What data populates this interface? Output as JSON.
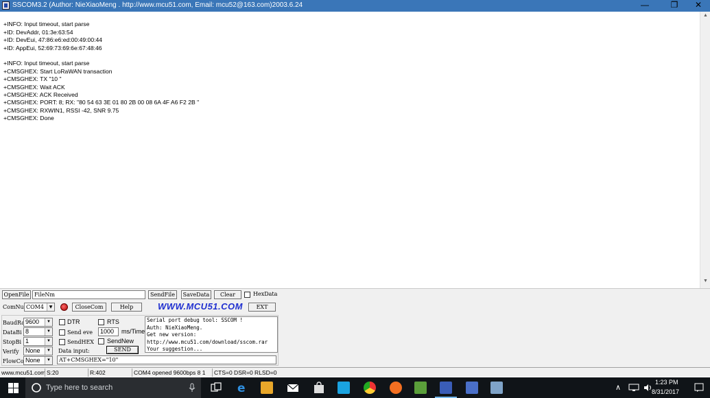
{
  "window": {
    "title": "SSCOM3.2 (Author: NieXiaoMeng .  http://www.mcu51.com,  Email: mcu52@163.com)2003.6.24",
    "min_glyph": "—",
    "max_glyph": "❐",
    "close_glyph": "✕"
  },
  "receive": {
    "lines": [
      "+INFO: Input timeout, start parse",
      "+ID: DevAddr, 01:3e:63:54",
      "+ID: DevEui, 47:86:e6:ed:00:49:00:44",
      "+ID: AppEui, 52:69:73:69:6e:67:48:46",
      "",
      "+INFO: Input timeout, start parse",
      "+CMSGHEX: Start LoRaWAN transaction",
      "+CMSGHEX: TX \"10 \"",
      "+CMSGHEX: Wait ACK",
      "+CMSGHEX: ACK Received",
      "+CMSGHEX: PORT: 8; RX: \"80 54 63 3E 01 80 2B 00 08 6A 4F A6 F2 2B \"",
      "+CMSGHEX: RXWIN1, RSSI -42, SNR 9.75",
      "+CMSGHEX: Done"
    ],
    "scroll_up": "▲",
    "scroll_down": "▼"
  },
  "controls": {
    "open_file": "OpenFile",
    "file_name": "FileNm",
    "send_file": "SendFile",
    "save_data": "SaveData",
    "clear": "Clear",
    "hex_data": "HexData",
    "com_num_label": "ComNum",
    "com_num_value": "COM4",
    "close_com": "CloseCom",
    "help": "Help",
    "site_url": "WWW.MCU51.COM",
    "ext": "EXT",
    "baud_label": "BaudRa",
    "baud_value": "9600",
    "databits_label": "DataBi",
    "databits_value": "8",
    "stopbits_label": "StopBi",
    "stopbits_value": "1",
    "verify_label": "Verify",
    "verify_value": "None",
    "flow_label": "FlowCo",
    "flow_value": "None",
    "dtr": "DTR",
    "rts": "RTS",
    "send_every": "Send eve",
    "interval_value": "1000",
    "ms_time": "ms/Time",
    "send_hex": "SendHEX",
    "send_new": "SendNew",
    "data_input_label": "Data input:",
    "send_button": "SEND",
    "data_input_value": "AT+CMSGHEX=\"10\"",
    "info_lines": [
      "Serial port debug tool: SSCOM !",
      "Auth: NieXiaoMeng.",
      "Get new version:",
      "http://www.mcu51.com/download/sscom.rar",
      "Your suggestion..."
    ]
  },
  "statusbar": {
    "site": "www.mcu51.com",
    "sent": "S:20",
    "received": "R:402",
    "port_status": "COM4 opened 9600bps  8 1",
    "signals": "CTS=0 DSR=0 RLSD=0"
  },
  "taskbar": {
    "search_placeholder": "Type here to search",
    "time": "1:23 PM",
    "date": "8/31/2017",
    "tray_chevron": "∧"
  },
  "colors": {
    "titlebar": "#3a76b8",
    "url": "#1f2fd0",
    "taskbar": "#101418"
  }
}
